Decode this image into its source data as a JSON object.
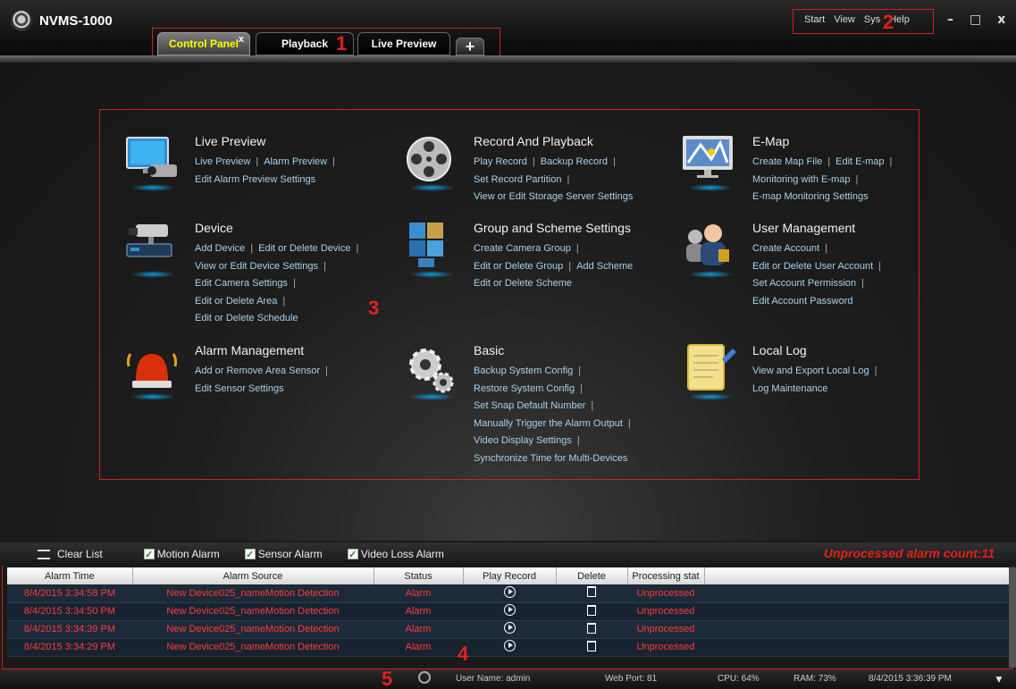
{
  "app": {
    "title": "NVMS-1000"
  },
  "tabs": [
    {
      "label": "Control Panel",
      "close": "x"
    },
    {
      "label": "Playback"
    },
    {
      "label": "Live Preview"
    },
    {
      "label": "+"
    }
  ],
  "menu": {
    "items": [
      "Start",
      "View",
      "Sys",
      "Help"
    ]
  },
  "window_controls": {
    "minimize": "–",
    "maximize": "□",
    "close": "x"
  },
  "annotations": {
    "n1": "1",
    "n2": "2",
    "n3": "3",
    "n4": "4",
    "n5": "5"
  },
  "modules": {
    "live_preview": {
      "title": "Live Preview",
      "lines": [
        [
          "Live Preview",
          "Alarm Preview"
        ],
        [
          "Edit Alarm Preview Settings"
        ]
      ]
    },
    "record_playback": {
      "title": "Record And Playback",
      "lines": [
        [
          "Play Record",
          "Backup Record"
        ],
        [
          "Set Record Partition"
        ],
        [
          "View or Edit Storage Server Settings"
        ]
      ]
    },
    "emap": {
      "title": "E-Map",
      "lines": [
        [
          "Create Map File",
          "Edit E-map"
        ],
        [
          "Monitoring with E-map"
        ],
        [
          "E-map Monitoring Settings"
        ]
      ]
    },
    "device": {
      "title": "Device",
      "lines": [
        [
          "Add Device",
          "Edit or Delete Device"
        ],
        [
          "View or Edit Device Settings"
        ],
        [
          "Edit Camera Settings"
        ],
        [
          "Edit or Delete Area"
        ],
        [
          "Edit or Delete Schedule"
        ]
      ]
    },
    "group_scheme": {
      "title": "Group and Scheme Settings",
      "lines": [
        [
          "Create Camera Group"
        ],
        [
          "Edit or Delete Group",
          "Add Scheme"
        ],
        [
          "Edit or Delete Scheme"
        ]
      ]
    },
    "user_mgmt": {
      "title": "User Management",
      "lines": [
        [
          "Create Account"
        ],
        [
          "Edit or Delete User Account"
        ],
        [
          "Set Account Permission"
        ],
        [
          "Edit Account Password"
        ]
      ]
    },
    "alarm_mgmt": {
      "title": "Alarm Management",
      "lines": [
        [
          "Add or Remove Area Sensor"
        ],
        [
          "Edit Sensor Settings"
        ]
      ]
    },
    "basic": {
      "title": "Basic",
      "lines": [
        [
          "Backup System Config"
        ],
        [
          "Restore System Config"
        ],
        [
          "Set Snap Default Number"
        ],
        [
          "Manually Trigger the Alarm Output"
        ],
        [
          "Video Display Settings"
        ],
        [
          "Synchronize Time for Multi-Devices"
        ]
      ]
    },
    "local_log": {
      "title": "Local Log",
      "lines": [
        [
          "View and Export Local Log"
        ],
        [
          "Log Maintenance"
        ]
      ]
    }
  },
  "alarm_panel": {
    "clear_list": "Clear List",
    "filters": [
      "Motion Alarm",
      "Sensor Alarm",
      "Video Loss Alarm"
    ],
    "unprocessed": "Unprocessed alarm count:11",
    "columns": [
      "Alarm Time",
      "Alarm Source",
      "Status",
      "Play Record",
      "Delete",
      "Processing stat"
    ],
    "rows": [
      {
        "time": "8/4/2015 3:34:58 PM",
        "source": "New Device025_nameMotion Detection",
        "status": "Alarm",
        "processing": "Unprocessed"
      },
      {
        "time": "8/4/2015 3:34:50 PM",
        "source": "New Device025_nameMotion Detection",
        "status": "Alarm",
        "processing": "Unprocessed"
      },
      {
        "time": "8/4/2015 3:34:39 PM",
        "source": "New Device025_nameMotion Detection",
        "status": "Alarm",
        "processing": "Unprocessed"
      },
      {
        "time": "8/4/2015 3:34:29 PM",
        "source": "New Device025_nameMotion Detection",
        "status": "Alarm",
        "processing": "Unprocessed"
      }
    ]
  },
  "statusbar": {
    "user": "User Name: admin",
    "port": "Web Port: 81",
    "cpu": "CPU: 64%",
    "ram": "RAM: 73%",
    "datetime": "8/4/2015 3:36:39 PM"
  }
}
